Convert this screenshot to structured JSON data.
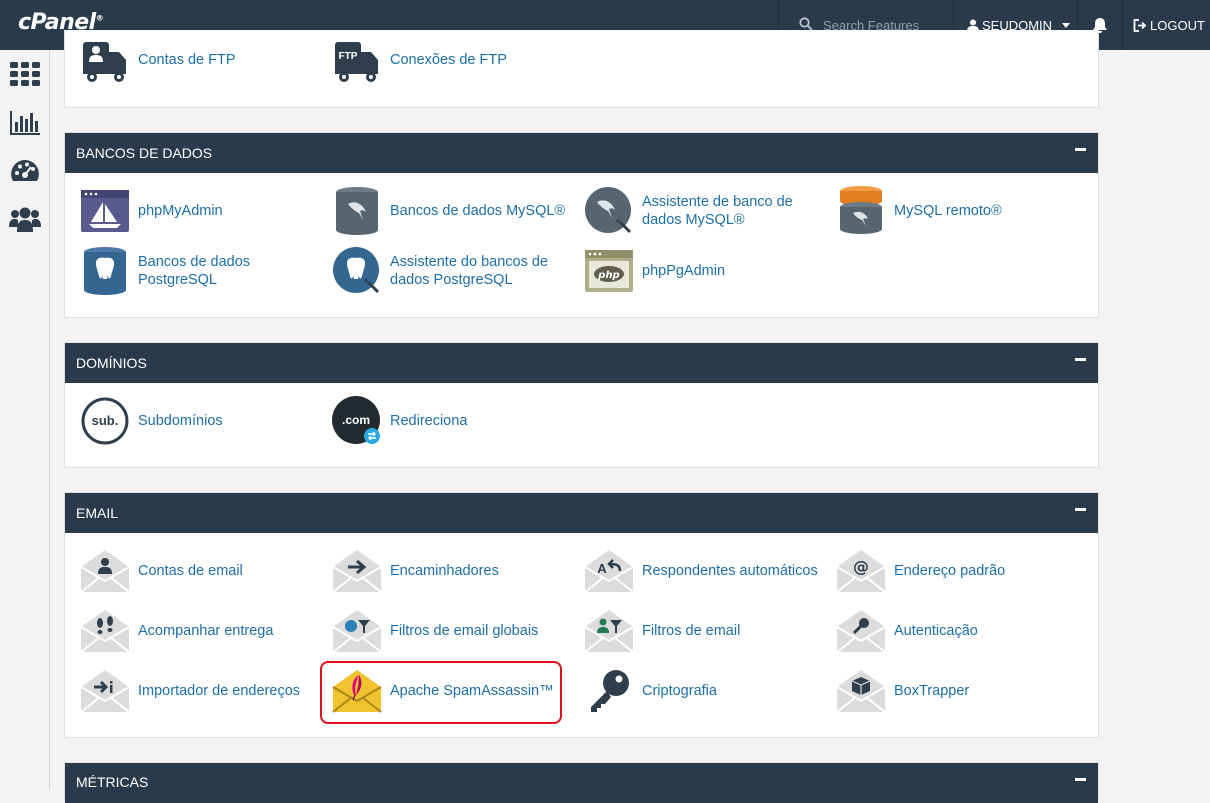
{
  "topbar": {
    "logo": "cPanel",
    "search_placeholder": "Search Features",
    "user": "SEUDOMIN",
    "logout": "LOGOUT"
  },
  "sidebar": [
    "grid-icon",
    "stats-icon",
    "dashboard-icon",
    "users-icon"
  ],
  "sections": {
    "files": {
      "items": [
        "Contas de FTP",
        "Conexões de FTP"
      ]
    },
    "databases": {
      "title": "BANCOS DE DADOS",
      "items": [
        "phpMyAdmin",
        "Bancos de dados MySQL®",
        "Assistente de banco de dados MySQL®",
        "MySQL remoto®",
        "Bancos de dados PostgreSQL",
        "Assistente do bancos de dados PostgreSQL",
        "phpPgAdmin"
      ]
    },
    "domains": {
      "title": "DOMÍNIOS",
      "items": [
        "Subdomínios",
        "Redireciona"
      ]
    },
    "email": {
      "title": "EMAIL",
      "items": [
        "Contas de email",
        "Encaminhadores",
        "Respondentes automáticos",
        "Endereço padrão",
        "Acompanhar entrega",
        "Filtros de email globais",
        "Filtros de email",
        "Autenticação",
        "Importador de endereços",
        "Apache SpamAssassin™",
        "Criptografia",
        "BoxTrapper"
      ]
    },
    "metrics": {
      "title": "MÉTRICAS"
    }
  },
  "colors": {
    "header": "#293a4a",
    "link": "#1e6ea7",
    "highlight": "#e3101b"
  }
}
